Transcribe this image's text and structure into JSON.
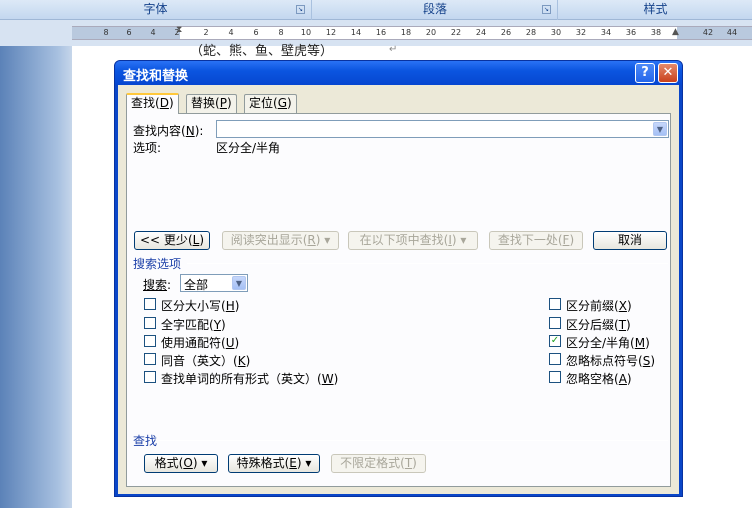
{
  "ribbon": {
    "groups": [
      {
        "label": "字体"
      },
      {
        "label": "段落"
      },
      {
        "label": "样式"
      }
    ]
  },
  "ruler": {
    "ticks": [
      "8",
      "6",
      "4",
      "2",
      "2",
      "4",
      "6",
      "8",
      "10",
      "12",
      "14",
      "16",
      "18",
      "20",
      "22",
      "24",
      "26",
      "28",
      "30",
      "32",
      "34",
      "36",
      "38",
      "42",
      "44"
    ]
  },
  "document": {
    "text": "（蛇、熊、鱼、壁虎等）"
  },
  "dialog": {
    "title": "查找和替换",
    "help_label": "?",
    "close_label": "✕",
    "tabs": [
      {
        "label": "查找",
        "key": "D"
      },
      {
        "label": "替换",
        "key": "P"
      },
      {
        "label": "定位",
        "key": "G"
      }
    ],
    "find": {
      "label": "查找内容",
      "key": "N",
      "value": "",
      "options_label": "选项:",
      "options_value": "区分全/半角"
    },
    "buttons": {
      "less": "<< 更少",
      "less_key": "L",
      "reading_highlight": "阅读突出显示",
      "reading_highlight_key": "R",
      "find_in": "在以下项中查找",
      "find_in_key": "I",
      "find_next": "查找下一处",
      "find_next_key": "F",
      "cancel": "取消"
    },
    "search_options": {
      "title": "搜索选项",
      "search_label": "搜索",
      "search_value": "全部",
      "left": [
        {
          "label": "区分大小写",
          "key": "H",
          "checked": false
        },
        {
          "label": "全字匹配",
          "key": "Y",
          "checked": false
        },
        {
          "label": "使用通配符",
          "key": "U",
          "checked": false
        },
        {
          "label": "同音（英文）",
          "key": "K",
          "checked": false
        },
        {
          "label": "查找单词的所有形式（英文）",
          "key": "W",
          "checked": false
        }
      ],
      "right": [
        {
          "label": "区分前缀",
          "key": "X",
          "checked": false
        },
        {
          "label": "区分后缀",
          "key": "T",
          "checked": false
        },
        {
          "label": "区分全/半角",
          "key": "M",
          "checked": true
        },
        {
          "label": "忽略标点符号",
          "key": "S",
          "checked": false
        },
        {
          "label": "忽略空格",
          "key": "A",
          "checked": false
        }
      ]
    },
    "find_section": {
      "title": "查找",
      "format": "格式",
      "format_key": "O",
      "special": "特殊格式",
      "special_key": "E",
      "no_format": "不限定格式",
      "no_format_key": "T"
    }
  }
}
